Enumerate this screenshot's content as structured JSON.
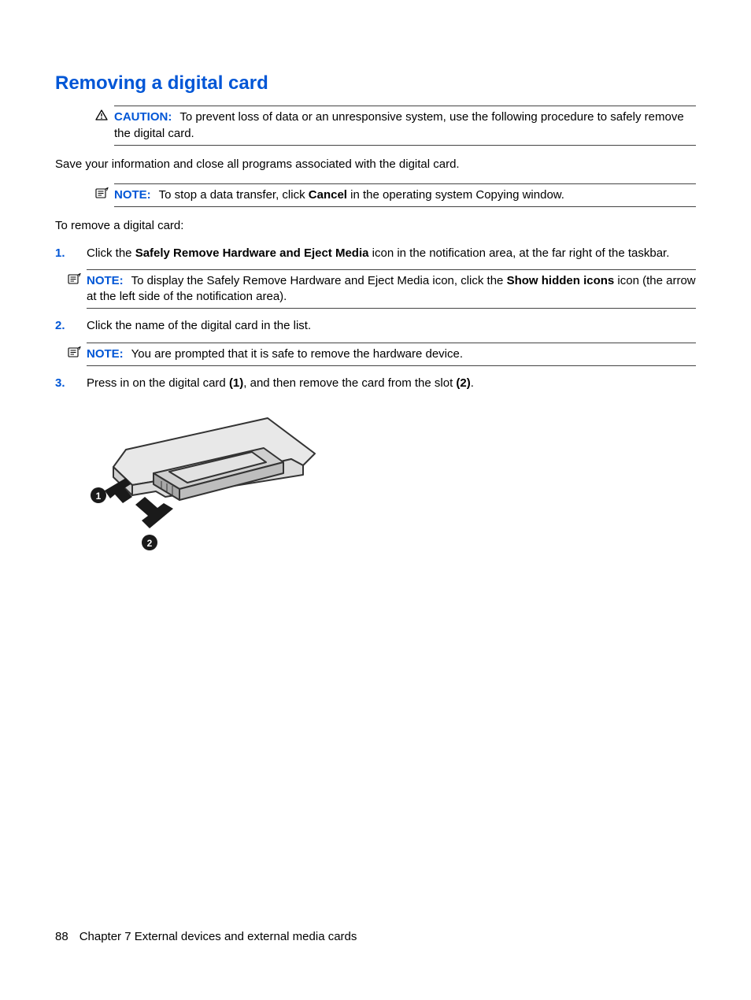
{
  "heading": "Removing a digital card",
  "caution": {
    "label": "CAUTION:",
    "text_a": "To prevent loss of data or an unresponsive system, use the following procedure to safely remove the digital card."
  },
  "para_save": "Save your information and close all programs associated with the digital card.",
  "note_transfer": {
    "label": "NOTE:",
    "pre": "To stop a data transfer, click ",
    "bold": "Cancel",
    "post": " in the operating system Copying window."
  },
  "para_to_remove": "To remove a digital card:",
  "steps": {
    "s1": {
      "num": "1.",
      "pre": "Click the ",
      "bold1": "Safely Remove Hardware and Eject Media",
      "post": " icon in the notification area, at the far right of the taskbar."
    },
    "s1_note": {
      "label": "NOTE:",
      "pre": "To display the Safely Remove Hardware and Eject Media icon, click the ",
      "bold1": "Show hidden icons",
      "post": " icon (the arrow at the left side of the notification area)."
    },
    "s2": {
      "num": "2.",
      "text": "Click the name of the digital card in the list."
    },
    "s2_note": {
      "label": "NOTE:",
      "text": "You are prompted that it is safe to remove the hardware device."
    },
    "s3": {
      "num": "3.",
      "pre": "Press in on the digital card ",
      "b1": "(1)",
      "mid": ", and then remove the card from the slot ",
      "b2": "(2)",
      "post": "."
    }
  },
  "footer": {
    "page": "88",
    "chapter": "Chapter 7   External devices and external media cards"
  },
  "illus": {
    "label1": "1",
    "label2": "2"
  }
}
